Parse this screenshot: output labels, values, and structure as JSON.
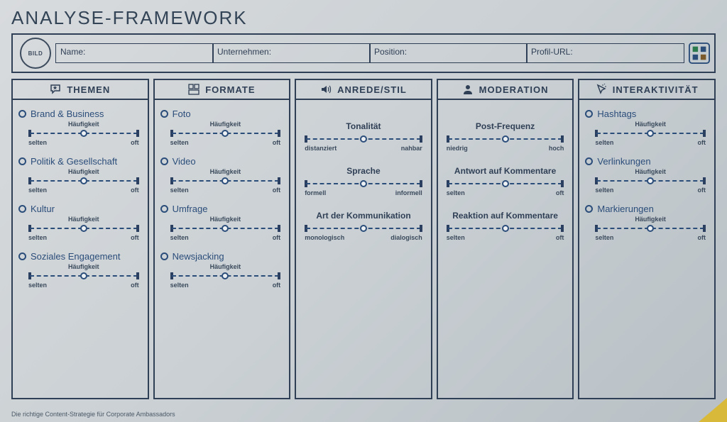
{
  "title": "ANALYSE-FRAMEWORK",
  "profile": {
    "bild": "BILD",
    "name_label": "Name:",
    "company_label": "Unternehmen:",
    "position_label": "Position:",
    "url_label": "Profil-URL:"
  },
  "slider_defaults": {
    "caption": "Häufigkeit",
    "left": "selten",
    "right": "oft"
  },
  "columns": [
    {
      "header": "THEMEN",
      "icon": "speech-star",
      "type": "freq",
      "items": [
        {
          "label": "Brand & Business"
        },
        {
          "label": "Politik & Gesellschaft"
        },
        {
          "label": "Kultur"
        },
        {
          "label": "Soziales Engagement"
        }
      ]
    },
    {
      "header": "FORMATE",
      "icon": "layout",
      "type": "freq",
      "items": [
        {
          "label": "Foto"
        },
        {
          "label": "Video"
        },
        {
          "label": "Umfrage"
        },
        {
          "label": "Newsjacking"
        }
      ]
    },
    {
      "header": "ANREDE/STIL",
      "icon": "speaker",
      "type": "center",
      "items": [
        {
          "title": "Tonalität",
          "left": "distanziert",
          "right": "nahbar"
        },
        {
          "title": "Sprache",
          "left": "formell",
          "right": "informell"
        },
        {
          "title": "Art der Kommunikation",
          "left": "monologisch",
          "right": "dialogisch"
        }
      ]
    },
    {
      "header": "MODERATION",
      "icon": "person",
      "type": "center",
      "items": [
        {
          "title": "Post-Frequenz",
          "left": "niedrig",
          "right": "hoch"
        },
        {
          "title": "Antwort auf Kommentare",
          "left": "selten",
          "right": "oft"
        },
        {
          "title": "Reaktion auf Kommentare",
          "left": "selten",
          "right": "oft"
        }
      ]
    },
    {
      "header": "INTERAKTIVITÄT",
      "icon": "cursor",
      "type": "freq",
      "items": [
        {
          "label": "Hashtags"
        },
        {
          "label": "Verlinkungen"
        },
        {
          "label": "Markierungen"
        }
      ]
    }
  ],
  "footer": "Die richtige Content-Strategie für Corporate Ambassadors"
}
